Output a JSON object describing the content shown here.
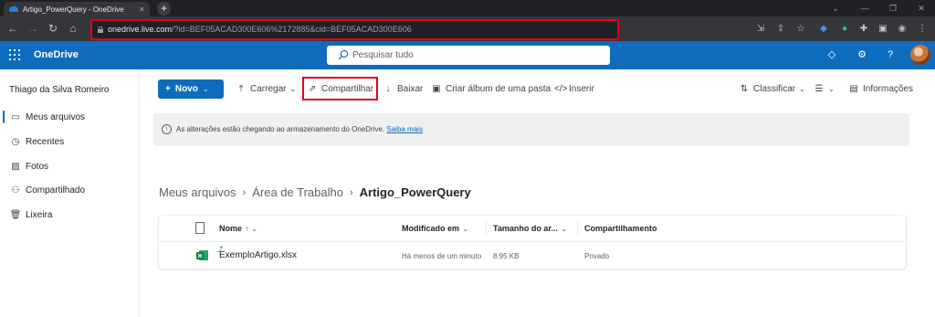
{
  "browser": {
    "tab_title": "Artigo_PowerQuery - OneDrive",
    "tab_close": "×",
    "new_tab": "+",
    "url_host": "onedrive.live.com",
    "url_rest": "/?id=BEF05ACAD300E606%2172885&cid=BEF05ACAD300E606",
    "window_controls": [
      "⌄",
      "—",
      "❐",
      "✕"
    ]
  },
  "suite": {
    "brand": "OneDrive",
    "search_placeholder": "Pesquisar tudo"
  },
  "leftnav": {
    "user_name": "Thiago da Silva Romeiro",
    "items": [
      {
        "label": "Meus arquivos",
        "icon": "folder-icon"
      },
      {
        "label": "Recentes",
        "icon": "clock-icon"
      },
      {
        "label": "Fotos",
        "icon": "photo-icon"
      },
      {
        "label": "Compartilhado",
        "icon": "people-icon"
      },
      {
        "label": "Lixeira",
        "icon": "trash-icon"
      }
    ]
  },
  "commands": {
    "new": "Novo",
    "upload": "Carregar",
    "share": "Compartilhar",
    "download": "Baixar",
    "album": "Criar álbum de uma pasta",
    "embed": "Inserir",
    "sort": "Classificar",
    "info": "Informações"
  },
  "banner": {
    "text": "As alterações estão chegando ao armazenamento do OneDrive.",
    "link": "Saiba mais"
  },
  "breadcrumb": [
    "Meus arquivos",
    "Área de Trabalho",
    "Artigo_PowerQuery"
  ],
  "table": {
    "headers": {
      "name": "Nome",
      "name_sort": "↑ ⌄",
      "modified": "Modificado em",
      "size": "Tamanho do ar...",
      "sharing": "Compartilhamento"
    },
    "rows": [
      {
        "name": "ExemploArtigo.xlsx",
        "modified": "Há menos de um minuto",
        "size": "8.95 KB",
        "sharing": "Privado"
      }
    ]
  },
  "colors": {
    "accent": "#0f6cbd",
    "highlight_box": "#e0001b"
  }
}
